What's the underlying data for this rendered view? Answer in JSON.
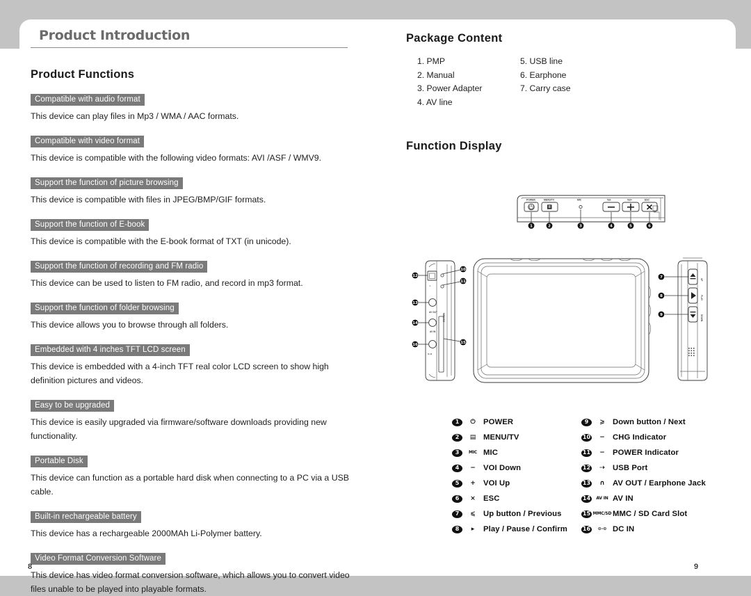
{
  "document": {
    "chapter_title": "Product Introduction",
    "page_number_left": "8",
    "page_number_right": "9"
  },
  "left_column": {
    "section_title": "Product Functions",
    "features": [
      {
        "tag": "Compatible with audio format",
        "body": "This device can play files in Mp3 / WMA / AAC formats."
      },
      {
        "tag": "Compatible with video format",
        "body": "This device is compatible with the following video formats: AVI /ASF / WMV9."
      },
      {
        "tag": "Support the function of picture browsing",
        "body": "This device is compatible with files in JPEG/BMP/GIF formats."
      },
      {
        "tag": "Support the function of E-book",
        "body": "This device is compatible with the E-book format of TXT (in unicode)."
      },
      {
        "tag": "Support the function of recording and FM radio",
        "body": "This device can be used to listen to FM radio, and record in mp3 format."
      },
      {
        "tag": "Support the function of folder browsing",
        "body": "This device allows you to browse through all folders."
      },
      {
        "tag": "Embedded with 4 inches TFT LCD screen",
        "body": "This device is embedded with a 4-inch TFT real color LCD screen to show high definition pictures and videos."
      },
      {
        "tag": "Easy to be upgraded",
        "body": "This device is easily upgraded via firmware/software downloads providing new functionality."
      },
      {
        "tag": "Portable Disk",
        "body": "This device can function as a portable hard disk when connecting to a PC via a USB cable."
      },
      {
        "tag": "Built-in rechargeable battery",
        "body": "This device has a rechargeable 2000MAh Li-Polymer battery."
      },
      {
        "tag": "Video Format Conversion Software",
        "body": "This device has video format conversion software, which allows you to convert video files unable to be played into playable formats."
      }
    ]
  },
  "right_column": {
    "package_content": {
      "heading": "Package Content",
      "column_a": [
        "1. PMP",
        "2. Manual",
        "3. Power Adapter",
        "4. AV line"
      ],
      "column_b": [
        "5. USB line",
        "6. Earphone",
        "7. Carry case"
      ]
    },
    "function_display": {
      "heading": "Function Display",
      "top_panel_labels": [
        "POWER",
        "MENU/TV",
        "MIC",
        "Vol-",
        "Vol+",
        "ESC"
      ],
      "top_panel_callouts": [
        "1",
        "2",
        "3",
        "4",
        "5",
        "6"
      ],
      "left_side_callouts": [
        "12",
        "13",
        "14",
        "16",
        "10",
        "11",
        "15"
      ],
      "right_side_callouts": [
        "7",
        "8",
        "9"
      ],
      "side_port_labels": [
        "MMC/SD",
        "AV OUT",
        "AV IN"
      ],
      "right_side_button_labels": [
        "UP",
        "PLAY",
        "DOWN"
      ],
      "legend": {
        "column_a": [
          {
            "num": "1",
            "icon": "power-icon",
            "glyph": "⏻",
            "label": "POWER"
          },
          {
            "num": "2",
            "icon": "menu-tv-icon",
            "glyph": "▤",
            "label": "MENU/TV"
          },
          {
            "num": "3",
            "icon": "mic-icon",
            "glyph": "MIC",
            "label": "MIC"
          },
          {
            "num": "4",
            "icon": "minus-icon",
            "glyph": "−",
            "label": "VOI Down"
          },
          {
            "num": "5",
            "icon": "plus-icon",
            "glyph": "+",
            "label": "VOI Up"
          },
          {
            "num": "6",
            "icon": "close-x-icon",
            "glyph": "×",
            "label": "ESC"
          },
          {
            "num": "7",
            "icon": "up-arrow-icon",
            "glyph": "⩽",
            "label": "Up button / Previous"
          },
          {
            "num": "8",
            "icon": "play-icon",
            "glyph": "▸",
            "label": "Play / Pause / Confirm"
          }
        ],
        "column_b": [
          {
            "num": "9",
            "icon": "down-arrow-icon",
            "glyph": "⩾",
            "label": "Down button / Next"
          },
          {
            "num": "10",
            "icon": "chg-indicator-icon",
            "glyph": "−",
            "label": "CHG Indicator"
          },
          {
            "num": "11",
            "icon": "power-indicator-icon",
            "glyph": "−",
            "label": "POWER Indicator"
          },
          {
            "num": "12",
            "icon": "usb-icon",
            "glyph": "⇢",
            "label": "USB Port"
          },
          {
            "num": "13",
            "icon": "earphone-icon",
            "glyph": "∩",
            "label": "AV OUT / Earphone Jack"
          },
          {
            "num": "14",
            "icon": "av-in-icon",
            "glyph": "AV IN",
            "label": "AV IN"
          },
          {
            "num": "15",
            "icon": "card-slot-icon",
            "glyph": "MMC/SD",
            "label": "MMC / SD Card Slot"
          },
          {
            "num": "16",
            "icon": "dc-in-icon",
            "glyph": "⊙–⊙",
            "label": "DC IN"
          }
        ]
      }
    }
  },
  "colors": {
    "page_background": "#c3c3c3",
    "sheet": "#ffffff",
    "chapter_title": "#6b6b6b",
    "feature_tag_background": "#7a7a7a",
    "body_text": "#1e1e1e"
  }
}
